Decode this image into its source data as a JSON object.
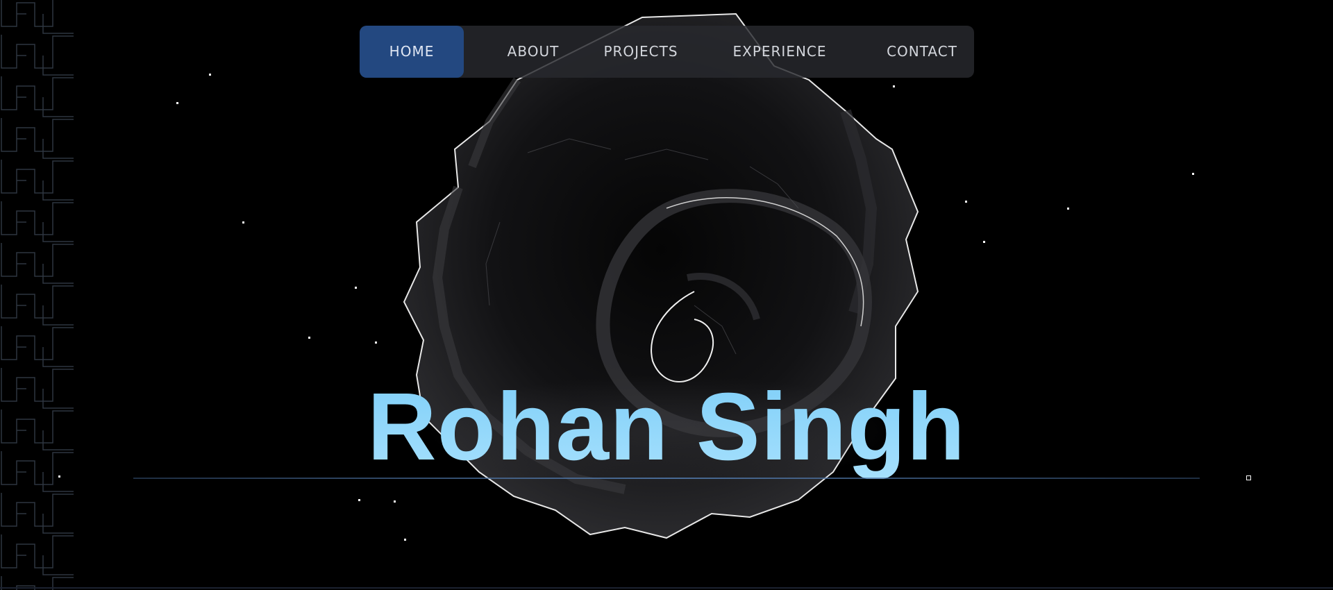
{
  "nav": {
    "items": [
      {
        "label": "HOME",
        "active": true
      },
      {
        "label": "ABOUT",
        "active": false
      },
      {
        "label": "PROJECTS",
        "active": false
      },
      {
        "label": "EXPERIENCE",
        "active": false
      },
      {
        "label": "CONTACT",
        "active": false
      }
    ]
  },
  "hero": {
    "name": "Rohan Singh"
  },
  "colors": {
    "background": "#000000",
    "nav_background": "#28292d",
    "nav_active": "#234880",
    "nav_text": "#d3d6dc",
    "hero_text": "#8fd6fb",
    "divider": "#4f79aa"
  },
  "icons": {
    "side_pattern": "greek-key-pattern",
    "background_art": "spiral-shell-graphic",
    "decor": "star-dots"
  }
}
